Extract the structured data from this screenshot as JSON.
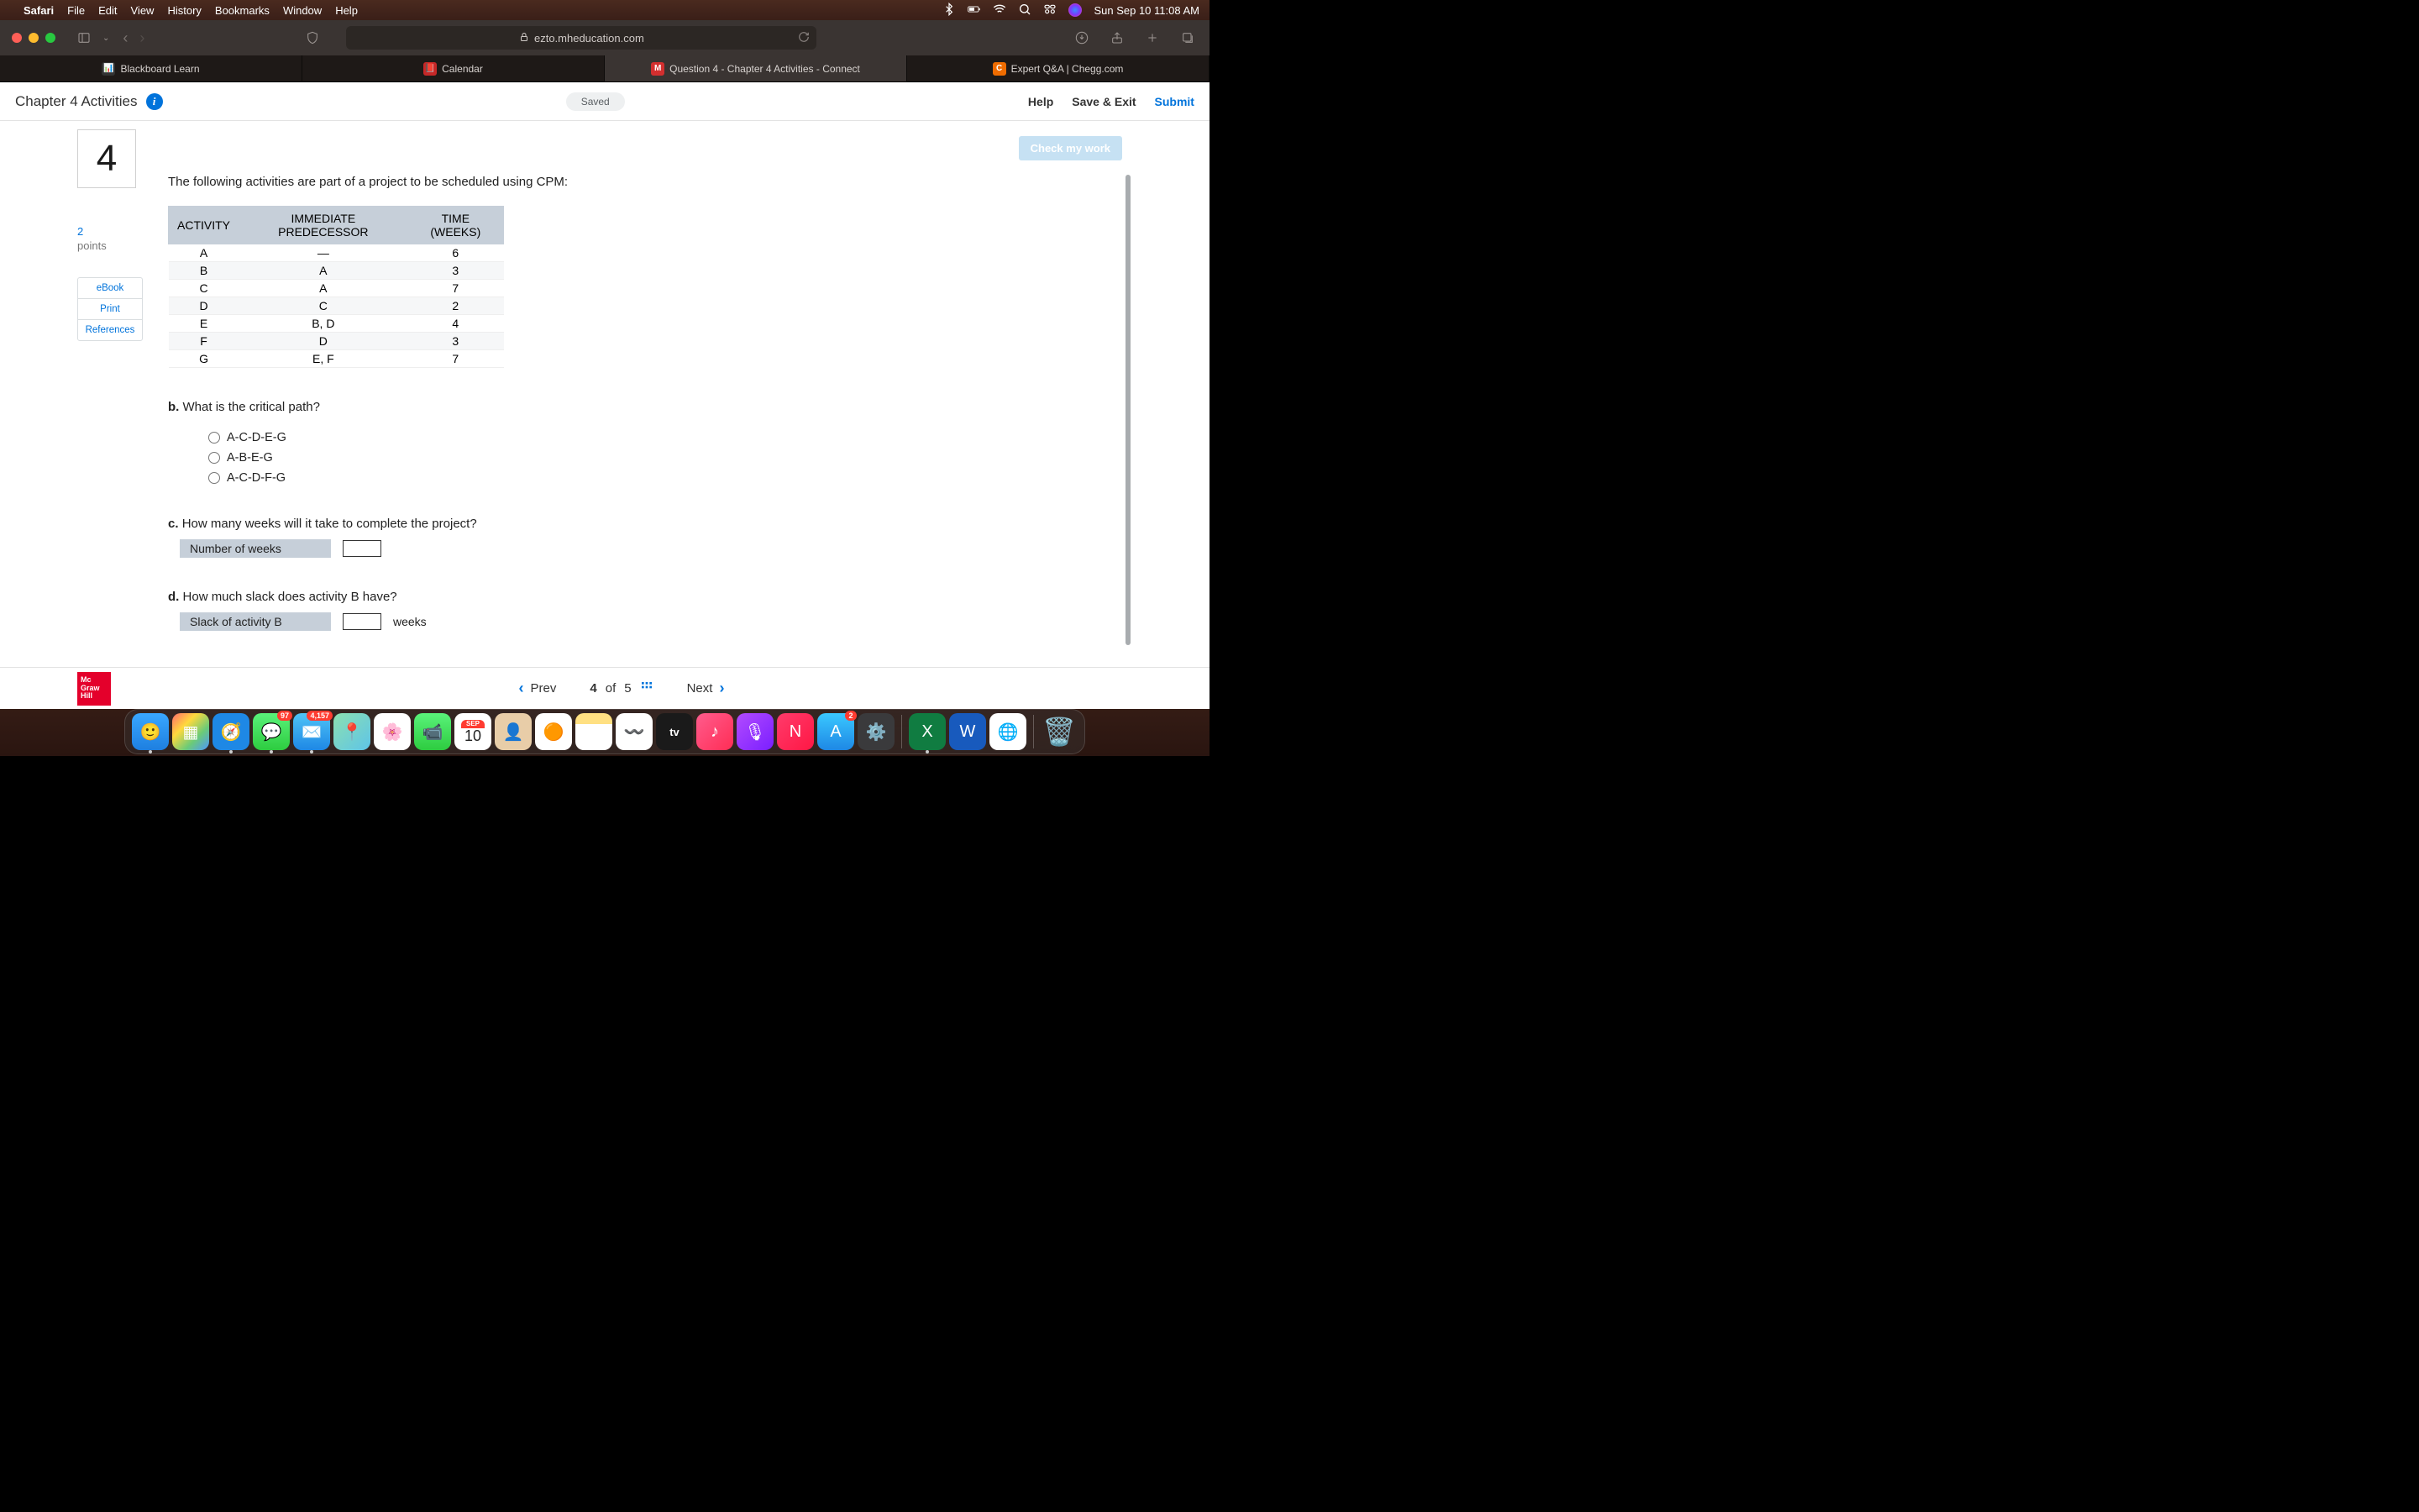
{
  "menubar": {
    "app": "Safari",
    "items": [
      "File",
      "Edit",
      "View",
      "History",
      "Bookmarks",
      "Window",
      "Help"
    ],
    "datetime": "Sun Sep 10  11:08 AM"
  },
  "browser": {
    "url_host": "ezto.mheducation.com",
    "tabs": [
      {
        "label": "Blackboard Learn",
        "favicon_bg": "#222",
        "favicon_text": "📊"
      },
      {
        "label": "Calendar",
        "favicon_bg": "#c62828",
        "favicon_text": ""
      },
      {
        "label": "Question 4 - Chapter 4 Activities - Connect",
        "favicon_bg": "#d32f2f",
        "favicon_text": "M",
        "active": true
      },
      {
        "label": "Expert Q&A | Chegg.com",
        "favicon_bg": "#ef6c00",
        "favicon_text": "C"
      }
    ]
  },
  "connect": {
    "title": "Chapter 4 Activities",
    "saved_label": "Saved",
    "links": {
      "help": "Help",
      "saveexit": "Save & Exit",
      "submit": "Submit"
    },
    "check_my_work": "Check my work",
    "question_no": "4",
    "points_value": "2",
    "points_label": "points",
    "side_links": {
      "ebook": "eBook",
      "print": "Print",
      "references": "References"
    },
    "intro": "The following activities are part of a project to be scheduled using CPM:",
    "table": {
      "headers": [
        "ACTIVITY",
        "IMMEDIATE PREDECESSOR",
        "TIME (WEEKS)"
      ],
      "rows": [
        [
          "A",
          "—",
          "6"
        ],
        [
          "B",
          "A",
          "3"
        ],
        [
          "C",
          "A",
          "7"
        ],
        [
          "D",
          "C",
          "2"
        ],
        [
          "E",
          "B, D",
          "4"
        ],
        [
          "F",
          "D",
          "3"
        ],
        [
          "G",
          "E, F",
          "7"
        ]
      ]
    },
    "part_b": {
      "label": "b.",
      "text": "What is the critical path?",
      "options": [
        "A-C-D-E-G",
        "A-B-E-G",
        "A-C-D-F-G"
      ]
    },
    "part_c": {
      "label": "c.",
      "text": "How many weeks will it take to complete the project?",
      "field_label": "Number of weeks"
    },
    "part_d": {
      "label": "d.",
      "text": "How much slack does activity B have?",
      "field_label": "Slack of activity B",
      "unit": "weeks"
    },
    "footer": {
      "prev": "Prev",
      "next": "Next",
      "page_current": "4",
      "page_of": "of",
      "page_total": "5",
      "logo_line1": "Mc",
      "logo_line2": "Graw",
      "logo_line3": "Hill"
    }
  },
  "dock": {
    "icons": [
      {
        "name": "finder",
        "bg": "linear-gradient(180deg,#39a7ff 0%,#1e7fe0 100%)",
        "glyph": "🙂",
        "running": true
      },
      {
        "name": "launchpad",
        "bg": "linear-gradient(135deg,#ff6b6b,#ffd93d,#6bcB77,#4d96ff)",
        "glyph": "▦"
      },
      {
        "name": "safari",
        "bg": "radial-gradient(circle,#fff 20%,#1e88e5 22%)",
        "glyph": "🧭",
        "running": true
      },
      {
        "name": "messages",
        "bg": "linear-gradient(180deg,#5af27a,#2ecc40)",
        "glyph": "💬",
        "badge": "97",
        "running": true
      },
      {
        "name": "mail",
        "bg": "linear-gradient(180deg,#4fc3f7,#1e88e5)",
        "glyph": "✉️",
        "badge": "4,157",
        "running": true
      },
      {
        "name": "maps",
        "bg": "linear-gradient(135deg,#8ce0b0,#5ec4e8)",
        "glyph": "📍"
      },
      {
        "name": "photos",
        "bg": "#fff",
        "glyph": "🌸"
      },
      {
        "name": "facetime",
        "bg": "linear-gradient(180deg,#5af27a,#2ecc40)",
        "glyph": "📹"
      },
      {
        "name": "calendar",
        "bg": "#fff",
        "glyph": "",
        "cal_month": "SEP",
        "cal_day": "10"
      },
      {
        "name": "contacts",
        "bg": "#e8cda8",
        "glyph": "👤"
      },
      {
        "name": "reminders",
        "bg": "#fff",
        "glyph": "🟠"
      },
      {
        "name": "notes",
        "bg": "linear-gradient(180deg,#ffe082 30%,#fff 30%)",
        "glyph": ""
      },
      {
        "name": "freeform",
        "bg": "#fff",
        "glyph": "〰️"
      },
      {
        "name": "appletv",
        "bg": "#1a1a1a",
        "glyph": "tv"
      },
      {
        "name": "music",
        "bg": "linear-gradient(135deg,#ff5c8d,#ff2d55)",
        "glyph": "♪"
      },
      {
        "name": "podcasts",
        "bg": "linear-gradient(135deg,#b24bff,#7a1fff)",
        "glyph": "🎙"
      },
      {
        "name": "news",
        "bg": "linear-gradient(135deg,#ff3b6b,#ff1744)",
        "glyph": "N"
      },
      {
        "name": "appstore",
        "bg": "linear-gradient(180deg,#3ac8ff,#1e88e5)",
        "glyph": "A",
        "badge": "2"
      },
      {
        "name": "preferences",
        "bg": "#3a3a3c",
        "glyph": "⚙️"
      }
    ],
    "right_icons": [
      {
        "name": "excel",
        "bg": "#107c41",
        "glyph": "X",
        "running": true
      },
      {
        "name": "word",
        "bg": "#185abd",
        "glyph": "W"
      },
      {
        "name": "chrome",
        "bg": "#fff",
        "glyph": "🌐"
      }
    ]
  }
}
